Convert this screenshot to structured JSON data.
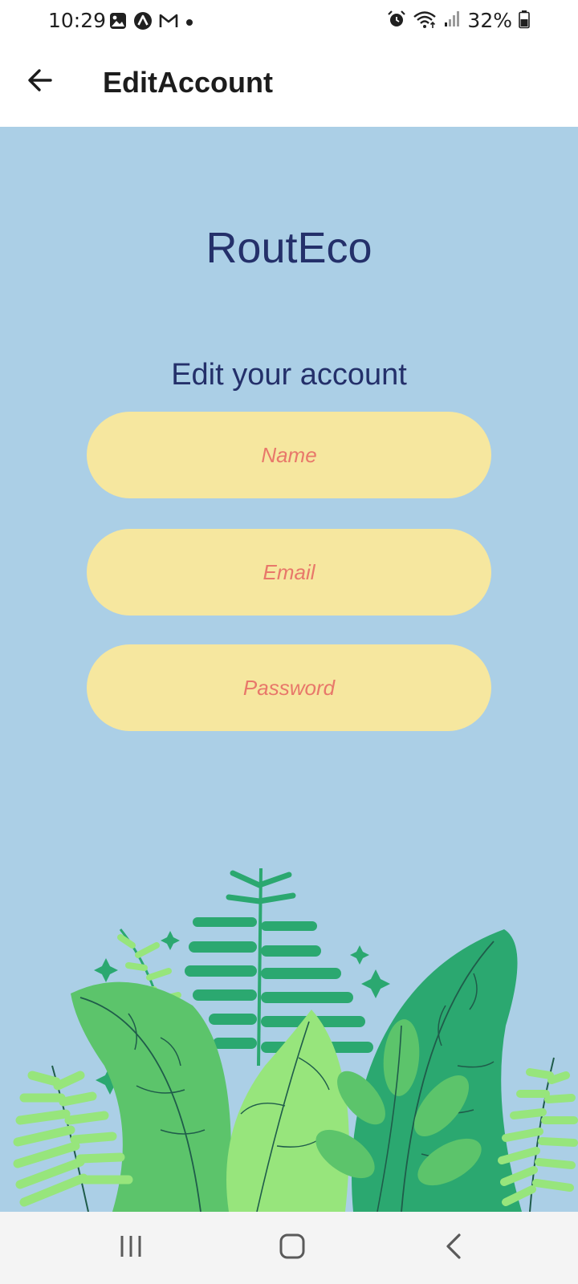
{
  "status_bar": {
    "time": "10:29",
    "battery_percent": "32%",
    "left_icons": [
      "gallery-icon",
      "arc-icon",
      "gmail-icon",
      "dot-icon"
    ],
    "right_icons": [
      "alarm-icon",
      "wifi-icon",
      "signal-icon",
      "battery-icon"
    ]
  },
  "app_bar": {
    "title": "EditAccount",
    "back_icon": "arrow-left-icon"
  },
  "main": {
    "brand": "RoutEco",
    "subtitle": "Edit your account",
    "fields": {
      "name": {
        "placeholder": "Name",
        "value": ""
      },
      "email": {
        "placeholder": "Email",
        "value": ""
      },
      "password": {
        "placeholder": "Password",
        "value": ""
      }
    }
  },
  "nav_bar": {
    "icons": [
      "recents-icon",
      "home-icon",
      "back-icon"
    ]
  },
  "colors": {
    "background": "#abcfe6",
    "field_fill": "#f6e79f",
    "placeholder_text": "#e8786a",
    "heading_text": "#24306a",
    "leaf_dark": "#2ba870",
    "leaf_mid": "#5cc46b",
    "leaf_light": "#97e57c"
  }
}
